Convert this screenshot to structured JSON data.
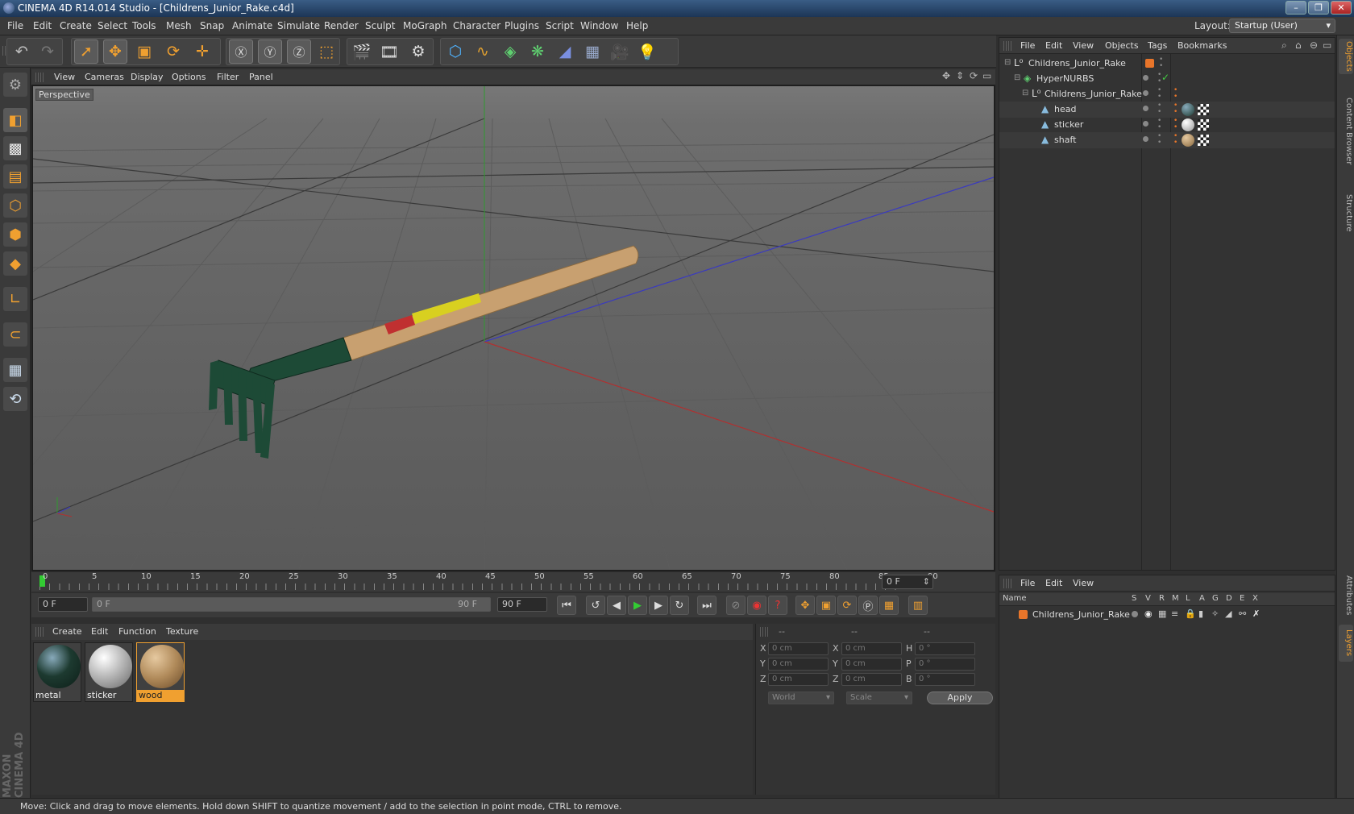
{
  "window": {
    "title": "CINEMA 4D R14.014 Studio - [Childrens_Junior_Rake.c4d]"
  },
  "menubar": {
    "items": [
      "File",
      "Edit",
      "Create",
      "Select",
      "Tools",
      "Mesh",
      "Snap",
      "Animate",
      "Simulate",
      "Render",
      "Sculpt",
      "MoGraph",
      "Character",
      "Plugins",
      "Script",
      "Window",
      "Help"
    ],
    "layout_label": "Layout:",
    "layout_value": "Startup (User)"
  },
  "viewport": {
    "menu": [
      "View",
      "Cameras",
      "Display",
      "Options",
      "Filter",
      "Panel"
    ],
    "label": "Perspective"
  },
  "timeline": {
    "ticks": [
      "0",
      "5",
      "10",
      "15",
      "20",
      "25",
      "30",
      "35",
      "40",
      "45",
      "50",
      "55",
      "60",
      "65",
      "70",
      "75",
      "80",
      "85",
      "90"
    ],
    "current_frame": "0 F"
  },
  "playbar": {
    "start_field": "0 F",
    "range_start": "0 F",
    "range_end": "90 F",
    "end_field": "90 F"
  },
  "materials": {
    "menu": [
      "Create",
      "Edit",
      "Function",
      "Texture"
    ],
    "items": [
      {
        "name": "metal",
        "color": "#1d3a30"
      },
      {
        "name": "sticker",
        "color": "#b9b9b9"
      },
      {
        "name": "wood",
        "color": "#b08a5a"
      }
    ]
  },
  "coords": {
    "headers": [
      "--",
      "--",
      "--"
    ],
    "rows": [
      {
        "a": "X",
        "av": "0 cm",
        "b": "X",
        "bv": "0 cm",
        "c": "H",
        "cv": "0 °"
      },
      {
        "a": "Y",
        "av": "0 cm",
        "b": "Y",
        "bv": "0 cm",
        "c": "P",
        "cv": "0 °"
      },
      {
        "a": "Z",
        "av": "0 cm",
        "b": "Z",
        "bv": "0 cm",
        "c": "B",
        "cv": "0 °"
      }
    ],
    "mode": "World",
    "type": "Scale",
    "apply": "Apply"
  },
  "objects": {
    "menu": [
      "File",
      "Edit",
      "View",
      "Objects",
      "Tags",
      "Bookmarks"
    ],
    "tree": [
      {
        "name": "Childrens_Junior_Rake",
        "level": 0
      },
      {
        "name": "HyperNURBS",
        "level": 1
      },
      {
        "name": "Childrens_Junior_Rake",
        "level": 2
      },
      {
        "name": "head",
        "level": 3
      },
      {
        "name": "sticker",
        "level": 3
      },
      {
        "name": "shaft",
        "level": 3
      }
    ]
  },
  "layers": {
    "menu": [
      "File",
      "Edit",
      "View"
    ],
    "columns": [
      "Name",
      "S",
      "V",
      "R",
      "M",
      "L",
      "A",
      "G",
      "D",
      "E",
      "X"
    ],
    "rows": [
      {
        "name": "Childrens_Junior_Rake"
      }
    ]
  },
  "right_tabs": [
    "Objects",
    "Content Browser",
    "Structure",
    "Attributes",
    "Layers"
  ],
  "brand": "MAXON CINEMA 4D",
  "status": "Move: Click and drag to move elements. Hold down SHIFT to quantize movement / add to the selection in point mode, CTRL to remove."
}
